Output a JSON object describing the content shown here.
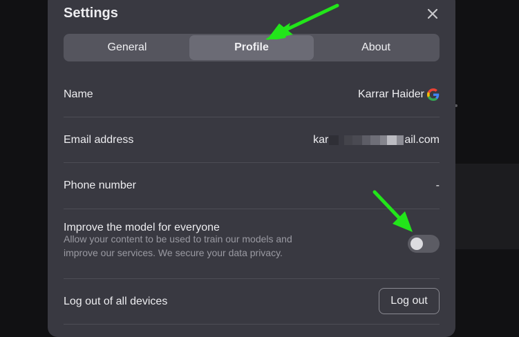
{
  "dialog": {
    "title": "Settings",
    "close_icon": "close-icon"
  },
  "tabs": [
    {
      "label": "General",
      "active": false
    },
    {
      "label": "Profile",
      "active": true
    },
    {
      "label": "About",
      "active": false
    }
  ],
  "profile": {
    "name": {
      "label": "Name",
      "value": "Karrar Haider",
      "provider_icon": "google-icon"
    },
    "email": {
      "label": "Email address",
      "value_start": "kar",
      "value_end": "ail.com"
    },
    "phone": {
      "label": "Phone number",
      "value": "-"
    },
    "improve_model": {
      "label": "Improve the model for everyone",
      "description": "Allow your content to be used to train our models and improve our services. We secure your data privacy.",
      "enabled": false
    },
    "logout_all": {
      "label": "Log out of all devices",
      "button_label": "Log out"
    }
  },
  "colors": {
    "dialog_bg": "#393941",
    "accent_annotation": "#22e51a",
    "text": "#ededf0",
    "muted_text": "#9a9aa2"
  }
}
